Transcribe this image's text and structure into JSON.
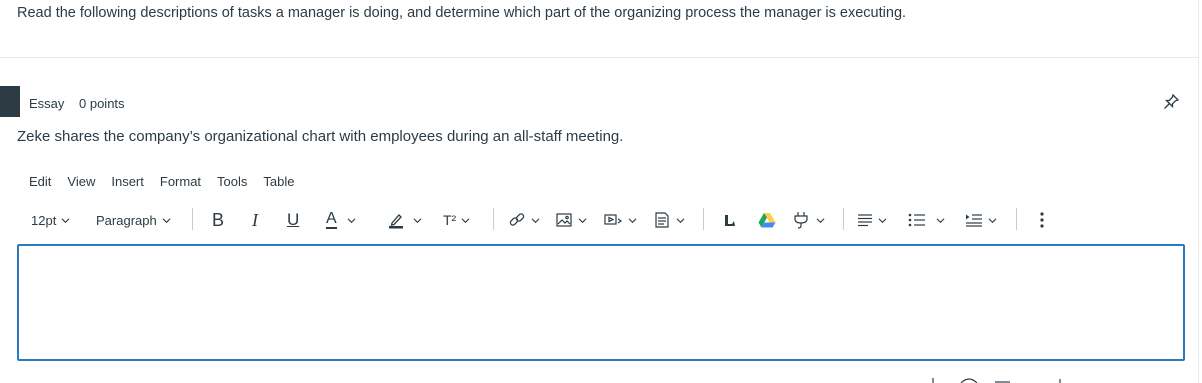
{
  "intro": {
    "text": "Read the following descriptions of tasks a manager is doing, and determine which part of the organizing process the manager is executing."
  },
  "question": {
    "type": "Essay",
    "points": "0 points",
    "text": "Zeke shares the company’s organizational chart with employees during an all-staff meeting."
  },
  "menubar": [
    "Edit",
    "View",
    "Insert",
    "Format",
    "Tools",
    "Table"
  ],
  "toolbar": {
    "font_size": "12pt",
    "block_format": "Paragraph",
    "bold": "B",
    "italic": "I",
    "underline": "U",
    "text_color": "A",
    "superscript": "T²"
  },
  "colors": {
    "text": "#2d3b45",
    "editor_border": "#2b7abc",
    "google_drive_icon": [
      "#1fa463",
      "#ffd04b",
      "#4688f4"
    ]
  },
  "icons": [
    "pin-icon",
    "highlight-icon",
    "link-icon",
    "image-icon",
    "media-icon",
    "document-icon",
    "apps-icon",
    "google-drive-icon",
    "plug-icon",
    "align-icon",
    "bullet-list-icon",
    "indent-icon",
    "more-icon"
  ]
}
